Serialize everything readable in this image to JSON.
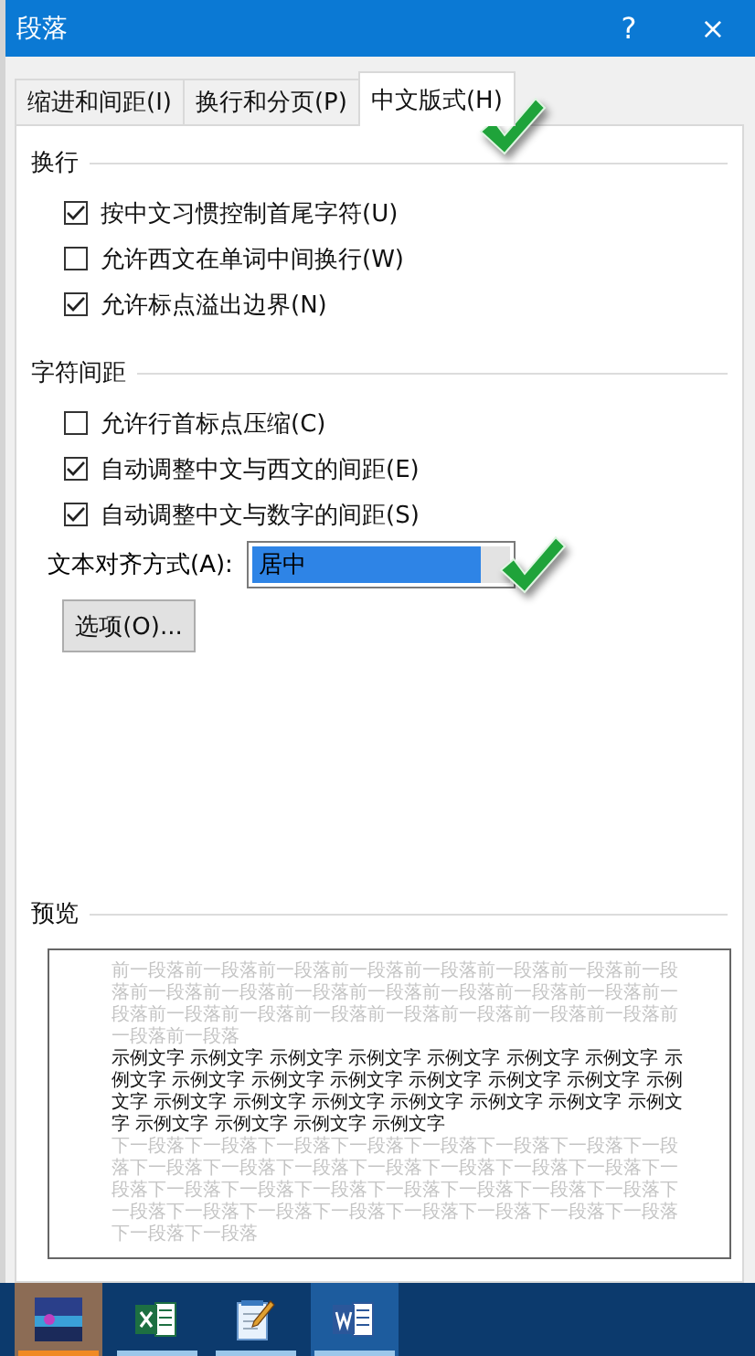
{
  "window": {
    "title": "段落",
    "help": "?",
    "close": "×"
  },
  "tabs": [
    {
      "label": "缩进和间距(I)",
      "selected": false
    },
    {
      "label": "换行和分页(P)",
      "selected": false
    },
    {
      "label": "中文版式(H)",
      "selected": true
    }
  ],
  "sections": [
    {
      "title": "换行",
      "options": [
        {
          "label": "按中文习惯控制首尾字符(U)",
          "checked": true
        },
        {
          "label": "允许西文在单词中间换行(W)",
          "checked": false
        },
        {
          "label": "允许标点溢出边界(N)",
          "checked": true
        }
      ]
    },
    {
      "title": "字符间距",
      "options": [
        {
          "label": "允许行首标点压缩(C)",
          "checked": false
        },
        {
          "label": "自动调整中文与西文的间距(E)",
          "checked": true
        },
        {
          "label": "自动调整中文与数字的间距(S)",
          "checked": true
        }
      ],
      "alignment": {
        "label": "文本对齐方式(A):",
        "value": "居中"
      },
      "button": "选项(O)..."
    }
  ],
  "preview": {
    "title": "预览",
    "previous": "前一段落前一段落前一段落前一段落前一段落前一段落前一段落前一段落前一段落前一段落前一段落前一段落前一段落前一段落前一段落前一段落前一段落前一段落前一段落前一段落前一段落前一段落前一段落前一段落前一段落",
    "sample": "示例文字 示例文字 示例文字 示例文字 示例文字 示例文字 示例文字 示例文字 示例文字 示例文字 示例文字 示例文字 示例文字 示例文字 示例文字 示例文字 示例文字 示例文字 示例文字 示例文字 示例文字 示例文字 示例文字 示例文字 示例文字 示例文字",
    "following": "下一段落下一段落下一段落下一段落下一段落下一段落下一段落下一段落下一段落下一段落下一段落下一段落下一段落下一段落下一段落下一段落下一段落下一段落下一段落下一段落下一段落下一段落下一段落下一段落下一段落下一段落下一段落下一段落下一段落下一段落下一段落下一段落下一段落"
  },
  "taskbar": {
    "items": [
      {
        "kind": "picture",
        "selected": false,
        "attention": true
      },
      {
        "kind": "excel",
        "selected": false,
        "attention": false
      },
      {
        "kind": "notepad",
        "selected": false,
        "attention": false
      },
      {
        "kind": "word",
        "selected": true,
        "attention": false
      }
    ]
  }
}
